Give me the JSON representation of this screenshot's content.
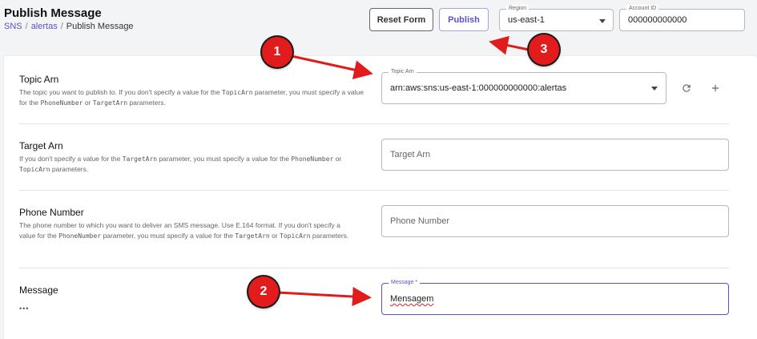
{
  "header": {
    "title": "Publish Message",
    "breadcrumb": {
      "items": [
        "SNS",
        "alertas",
        "Publish Message"
      ],
      "separator": "/"
    },
    "reset_label": "Reset Form",
    "publish_label": "Publish",
    "region": {
      "label": "Region",
      "value": "us-east-1"
    },
    "account": {
      "label": "Account ID",
      "value": "000000000000"
    }
  },
  "form": {
    "topic_arn": {
      "title": "Topic Arn",
      "help": [
        "The topic you want to publish to. If you don't specify a value for the ",
        "TopicArn",
        " parameter, you must specify a value for the ",
        "PhoneNumber",
        " or ",
        "TargetArn",
        " parameters."
      ],
      "label": "Topic Arn",
      "value": "arn:aws:sns:us-east-1:000000000000:alertas"
    },
    "target_arn": {
      "title": "Target Arn",
      "help": [
        "If you don't specify a value for the ",
        "TargetArn",
        " parameter, you must specify a value for the ",
        "PhoneNumber",
        " or ",
        "TopicArn",
        " parameters."
      ],
      "placeholder": "Target Arn"
    },
    "phone_number": {
      "title": "Phone Number",
      "help": [
        "The phone number to which you want to deliver an SMS message. Use E.164 format. If you don't specify a value for the ",
        "PhoneNumber",
        " parameter, you must specify a value for the ",
        "TargetArn",
        " or ",
        "TopicArn",
        " parameters."
      ],
      "placeholder": "Phone Number"
    },
    "message": {
      "title": "Message",
      "ellipsis": "•••",
      "label": "Message *",
      "value": "Mensagem"
    }
  },
  "annotations": [
    {
      "number": "1"
    },
    {
      "number": "2"
    },
    {
      "number": "3"
    }
  ],
  "colors": {
    "accent": "#5b52c8",
    "annotation": "#e21c1c",
    "background": "#f3f4f6"
  },
  "icons": [
    "caret-down-icon",
    "refresh-icon",
    "plus-icon"
  ]
}
